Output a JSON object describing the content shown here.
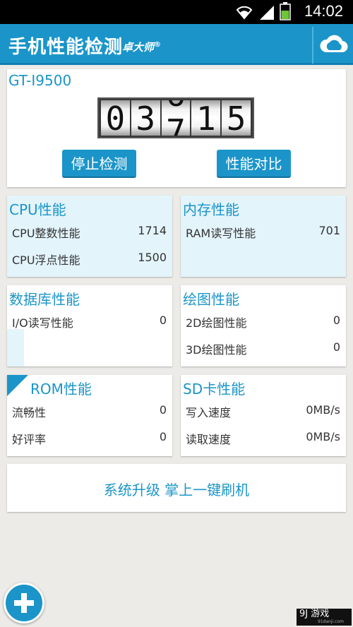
{
  "status_bar": {
    "time": "14:02"
  },
  "app_bar": {
    "title": "手机性能检测",
    "brand": "卓大师",
    "brand_mark": "®"
  },
  "device": {
    "model": "GT-I9500",
    "score_digits": [
      "0",
      "3",
      "7",
      "1",
      "5"
    ],
    "rolling_digit_prev": "6",
    "stop_label": "停止检测",
    "compare_label": "性能对比"
  },
  "cpu": {
    "title": "CPU性能",
    "rows": [
      {
        "label": "CPU整数性能",
        "value": "1714"
      },
      {
        "label": "CPU浮点性能",
        "value": "1500"
      }
    ]
  },
  "memory": {
    "title": "内存性能",
    "rows": [
      {
        "label": "RAM读写性能",
        "value": "701"
      }
    ]
  },
  "database": {
    "title": "数据库性能",
    "rows": [
      {
        "label": "I/O读写性能",
        "value": "0"
      }
    ]
  },
  "graphics": {
    "title": "绘图性能",
    "rows": [
      {
        "label": "2D绘图性能",
        "value": "0"
      },
      {
        "label": "3D绘图性能",
        "value": "0"
      }
    ]
  },
  "rom": {
    "title": "ROM性能",
    "rows": [
      {
        "label": "流畅性",
        "value": "0"
      },
      {
        "label": "好评率",
        "value": "0"
      }
    ]
  },
  "sd": {
    "title": "SD卡性能",
    "rows": [
      {
        "label": "写入速度",
        "value": "0MB/s"
      },
      {
        "label": "读取速度",
        "value": "0MB/s"
      }
    ]
  },
  "upgrade": {
    "text": "系统升级  掌上一键刷机"
  },
  "watermark": {
    "text": "9J 游戏",
    "url": "91danji.com"
  },
  "icons": [
    "wifi-icon",
    "signal-icon",
    "battery-icon",
    "cloud-icon",
    "plus-icon"
  ],
  "colors": {
    "accent": "#1b95c9",
    "tint": "#e3f4fb",
    "background": "#ecebe7"
  }
}
